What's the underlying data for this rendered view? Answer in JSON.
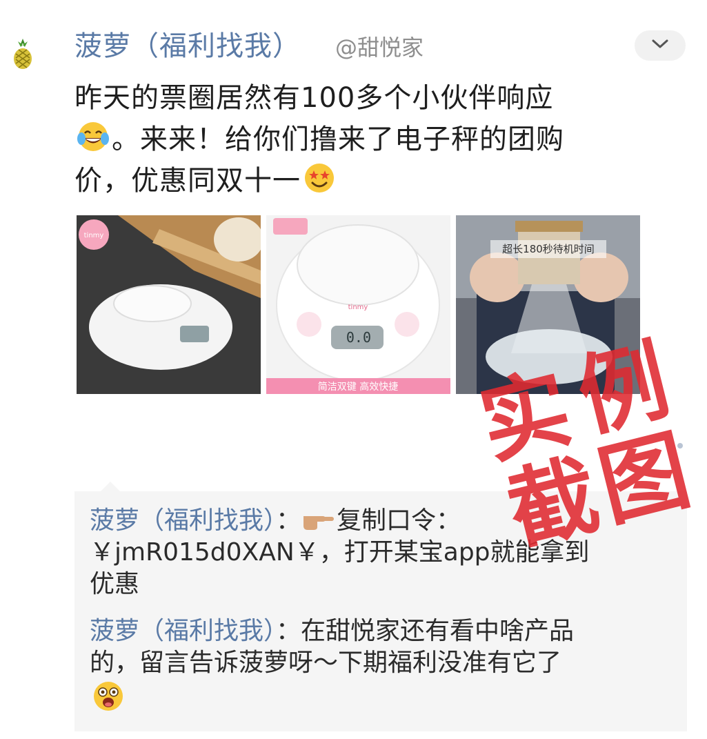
{
  "post": {
    "author": "菠萝（福利找我）",
    "handle": "@甜悦家",
    "text_line1": "昨天的票圈居然有100多个小伙伴响应",
    "text_line2": "。来来！给你们撸来了电子秤的团购",
    "text_line3a": "价，优惠同双十一",
    "emoji_laugh": "face-with-tears-of-joy",
    "emoji_love": "star-struck-face",
    "images": [
      {
        "brand": "tinmy",
        "desc": "white kitchen scale on table"
      },
      {
        "brand": "tinmy",
        "display": "0.0",
        "caption": "简洁双键  高效快捷"
      },
      {
        "overlay": "超长180秒待机时间"
      }
    ]
  },
  "comments": [
    {
      "author": "菠萝（福利找我）",
      "sep": "：",
      "icon": "pointing-hand",
      "text_a": "复制口令：",
      "text_b": "￥jmR015d0XAN￥，打开某宝app就能拿到",
      "text_c": "优惠"
    },
    {
      "author": "菠萝（福利找我）",
      "sep": "：",
      "text_a": "在甜悦家还有看中啥产品",
      "text_b": "的，留言告诉菠萝呀～下期福利没准有它了",
      "emoji": "astonished-face"
    }
  ],
  "stamp": {
    "line1": [
      "实",
      "例"
    ],
    "line2": [
      "截",
      "图"
    ],
    "color": "#e02a31"
  },
  "colors": {
    "author": "#5a7aa6",
    "comment_bg": "#f5f5f5",
    "scale_pink": "#f48fb1"
  }
}
